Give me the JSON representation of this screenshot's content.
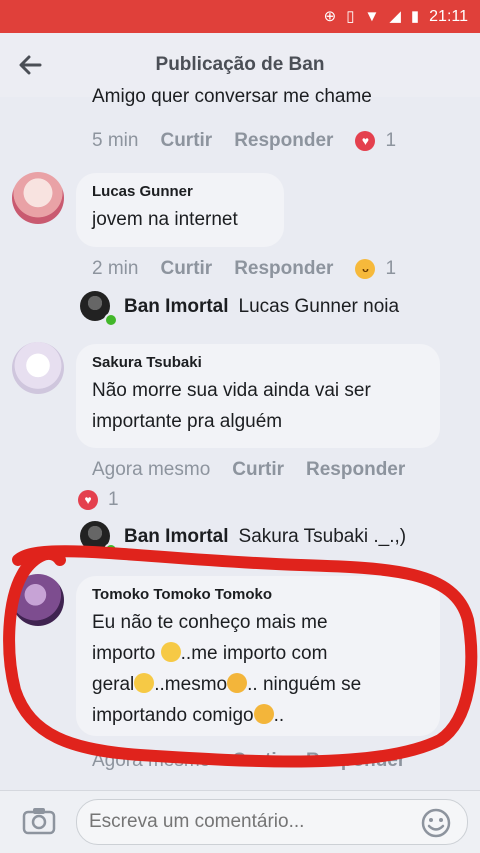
{
  "status_bar": {
    "time": "21:11"
  },
  "header": {
    "title": "Publicação de Ban"
  },
  "cut_comment": {
    "text": "Amigo quer conversar me chame",
    "time": "5 min",
    "like_label": "Curtir",
    "reply_label": "Responder",
    "reaction_count": "1"
  },
  "comments": [
    {
      "author": "Lucas Gunner",
      "text": "jovem na internet",
      "time": "2 min",
      "like_label": "Curtir",
      "reply_label": "Responder",
      "reaction_count": "1",
      "reply": {
        "author": "Ban Imortal",
        "text": "Lucas Gunner noia"
      }
    },
    {
      "author": "Sakura Tsubaki",
      "text": "Não morre sua vida ainda vai ser importante pra alguém",
      "time": "Agora mesmo",
      "like_label": "Curtir",
      "reply_label": "Responder",
      "reaction_count": "1",
      "reply": {
        "author": "Ban Imortal",
        "text": "Sakura Tsubaki ._.,)"
      }
    },
    {
      "author": "Tomoko Tomoko Tomoko",
      "text_parts": [
        "Eu não te conheço mais me",
        "importo ",
        "..me importo com",
        "geral",
        "..mesmo",
        ".. ninguém se",
        "importando comigo",
        ".."
      ],
      "time": "Agora mesmo",
      "like_label": "Curtir",
      "reply_label": "Responder"
    }
  ],
  "composer": {
    "placeholder": "Escreva um comentário..."
  },
  "colors": {
    "status_bar": "#e0403a",
    "annotation": "#e0231c",
    "heart": "#e4404e",
    "online": "#42b72a"
  }
}
